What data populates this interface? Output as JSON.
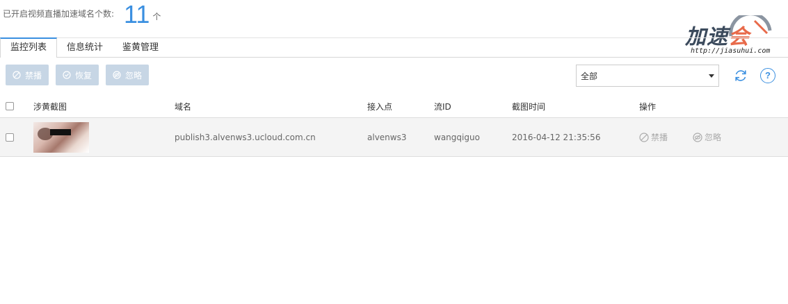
{
  "summary": {
    "label": "已开启视频直播加速域名个数:",
    "count": "11",
    "unit": "个"
  },
  "logo": {
    "text_main": "加速",
    "text_accent": "会",
    "url": "http://jiasuhui.com"
  },
  "tabs": [
    {
      "label": "监控列表",
      "active": true
    },
    {
      "label": "信息统计",
      "active": false
    },
    {
      "label": "鉴黄管理",
      "active": false
    }
  ],
  "toolbar": {
    "ban_label": "禁播",
    "restore_label": "恢复",
    "ignore_label": "忽略"
  },
  "filter": {
    "selected": "全部"
  },
  "table": {
    "headers": {
      "screenshot": "涉黄截图",
      "domain": "域名",
      "access_point": "接入点",
      "stream_id": "流ID",
      "capture_time": "截图时间",
      "actions": "操作"
    },
    "rows": [
      {
        "domain": "publish3.alvenws3.ucloud.com.cn",
        "access_point": "alvenws3",
        "stream_id": "wangqiguo",
        "capture_time": "2016-04-12 21:35:56",
        "ban_label": "禁播",
        "ignore_label": "忽略"
      }
    ]
  },
  "colors": {
    "accent": "#3a8fe0",
    "disabled_button": "#c7d6e5",
    "row_bg": "#f4f4f4"
  }
}
